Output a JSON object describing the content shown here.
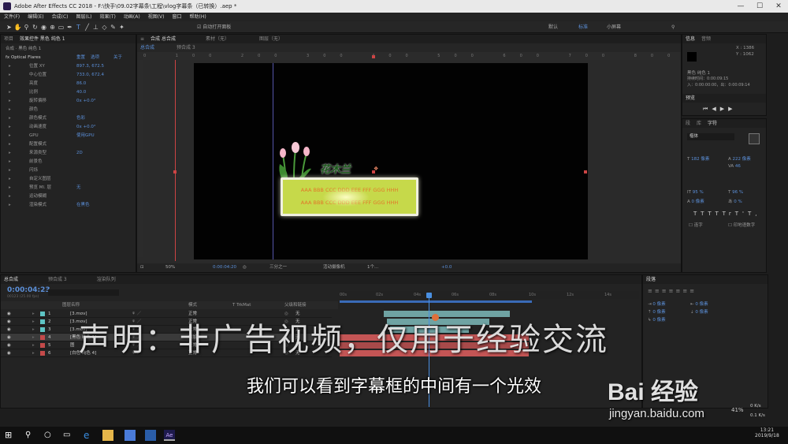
{
  "window": {
    "title": "Adobe After Effects CC 2018 - F:\\快手\\09.02字幕条\\工程\\vlog字幕条（已转换）.aep *",
    "minimize": "—",
    "maximize": "☐",
    "close": "✕"
  },
  "menu": [
    "文件(F)",
    "编辑(E)",
    "合成(C)",
    "图层(L)",
    "效果(T)",
    "动画(A)",
    "视图(V)",
    "窗口",
    "帮助(H)"
  ],
  "toolbar": {
    "auto_open": "自动打开面板",
    "workspace": [
      "默认",
      "标准",
      "小屏幕"
    ]
  },
  "effect_panel": {
    "tabs": [
      "项目",
      "效果控件 黑色 纯色 1"
    ],
    "layer": "合成 · 黑色 纯色 1",
    "effect_name": "Optical Flares",
    "effect_links": [
      "重置",
      "选项",
      "关于"
    ],
    "props": [
      {
        "label": "位置 XY",
        "value": "897.3, 672.5"
      },
      {
        "label": "中心位置",
        "value": "733.0, 672.4"
      },
      {
        "label": "亮度",
        "value": "86.0"
      },
      {
        "label": "比例",
        "value": "40.0"
      },
      {
        "label": "旋转偏移",
        "value": "0x +0.0°"
      },
      {
        "label": "颜色",
        "value": ""
      },
      {
        "label": "颜色模式",
        "value": "色彩"
      },
      {
        "label": "动画速度",
        "value": "0x +0.0°"
      },
      {
        "label": "GPU",
        "value": "使用GPU"
      },
      {
        "label": "配置模式",
        "value": ""
      },
      {
        "label": "来源类型",
        "value": "2D"
      },
      {
        "label": "前景色",
        "value": ""
      },
      {
        "label": "闪烁",
        "value": ""
      },
      {
        "label": "自定义图层",
        "value": ""
      },
      {
        "label": "预览 Ml. 层",
        "value": "无"
      },
      {
        "label": "运动模糊",
        "value": ""
      },
      {
        "label": "渲染模式",
        "value": "在黑色"
      }
    ]
  },
  "comp_panel": {
    "tabs": [
      "合成 总合成",
      "素材（无）",
      "图层（无）"
    ],
    "subtabs": [
      "总合成",
      "预合成 3"
    ],
    "zoom": "50%",
    "time": "0:00:04:20",
    "resolution": "三分之一",
    "camera": "活动摄像机",
    "views": "1个...",
    "exposure": "+0.0"
  },
  "video": {
    "flower_text": "花木兰",
    "line1": "AAA BBB CCC DDD EEE FFF GGG HHH",
    "line2": "AAA BBB CCC DDD EEE FFF GGG HHH"
  },
  "info_panel": {
    "tabs": [
      "信息",
      "音频"
    ],
    "x": "X : 1386",
    "y": "Y : 1062",
    "layer": "黑色 纯色 1",
    "duration": "持续时间：0:00:09:15",
    "in_out": "入：0:00:00:00，出：0:00:09:14",
    "preview_tab": "预览"
  },
  "char_panel": {
    "tabs": [
      "段",
      "库",
      "字符"
    ],
    "font": "楷体",
    "size": "182 像素",
    "leading": "222 像素",
    "tracking": "46",
    "scale_v": "95 %",
    "scale_h": "96 %",
    "baseline": "0 像素",
    "tsume": "0 %",
    "ligatures": "连字",
    "hindi": "印地语数字",
    "styles": [
      "T",
      "T",
      "TT",
      "Tr",
      "T'",
      "T,"
    ]
  },
  "timeline": {
    "tabs": [
      "总合成",
      "预合成 3",
      "渲染队列"
    ],
    "timecode": "0:00:04:23",
    "frames": "00123 (25.00 fps)",
    "headers": [
      "图层名称",
      "模式",
      "T TrkMat",
      "父级和链接"
    ],
    "ruler": [
      "00s",
      "02s",
      "04s",
      "06s",
      "08s",
      "10s",
      "12s",
      "14s"
    ],
    "layers": [
      {
        "num": "1",
        "name": "[3.mov]",
        "mode": "正常",
        "parent": "无",
        "color": "#5ec4c4"
      },
      {
        "num": "2",
        "name": "[3.mov]",
        "mode": "正常",
        "parent": "无",
        "color": "#5ec4c4"
      },
      {
        "num": "3",
        "name": "[3.mov]",
        "mode": "正常",
        "parent": "无",
        "color": "#5ec4c4"
      },
      {
        "num": "4",
        "name": "[黑色 纯色 1]",
        "mode": "相加",
        "parent": "无",
        "color": "#c44a4a"
      },
      {
        "num": "5",
        "name": "图",
        "mode": "正常",
        "parent": "无",
        "color": "#c44a4a"
      },
      {
        "num": "6",
        "name": "[白色 纯色 4]",
        "mode": "正常",
        "parent": "无",
        "color": "#c44a4a"
      }
    ]
  },
  "align_panel": {
    "tabs": [
      "段落"
    ],
    "values": [
      "0 像素",
      "0 像素",
      "0 像素",
      "0 像素",
      "0 像素"
    ]
  },
  "overlay": {
    "statement": "声明：非广告视频，仅用于经验交流",
    "subtitle": "我们可以看到字幕框的中间有一个光效",
    "watermark": "Bai 经验",
    "watermark_url": "jingyan.baidu.com"
  },
  "taskbar": {
    "time": "13:21",
    "date": "2019/9/18",
    "speed_up": "0 K/s",
    "speed_down": "0.1 K/s",
    "cpu": "41%"
  }
}
